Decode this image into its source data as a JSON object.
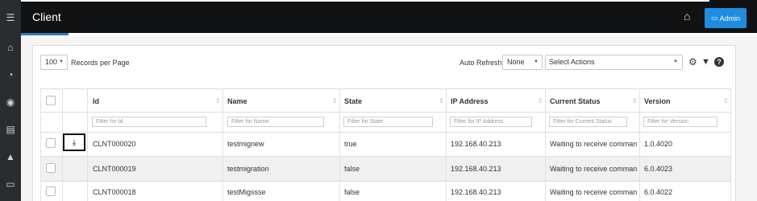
{
  "header": {
    "title": "Client",
    "admin_label": "Admin"
  },
  "sidebar": {
    "icons": [
      "menu-icon",
      "home-icon",
      "dashboard-icon",
      "binoculars-icon",
      "list-icon",
      "alert-icon",
      "monitor-icon"
    ]
  },
  "toolbar": {
    "page_size": "100",
    "records_label": "Records per Page",
    "auto_refresh_label": "Auto Refresh:",
    "auto_refresh_value": "None",
    "actions_value": "Select Actions"
  },
  "table": {
    "columns": [
      "Id",
      "Name",
      "State",
      "IP Address",
      "Current Status",
      "Version"
    ],
    "filters": [
      "Filter for Id",
      "Filter for Name",
      "Filter for State",
      "Filter for IP Address",
      "Filter for Current Status",
      "Filter for Version"
    ],
    "rows": [
      {
        "id": "CLNT000020",
        "name": "testmignew",
        "state": "true",
        "ip": "192.168.40.213",
        "status": "Waiting to receive comman...",
        "version": "1.0.4020"
      },
      {
        "id": "CLNT000019",
        "name": "testmigration",
        "state": "false",
        "ip": "192.168.40.213",
        "status": "Waiting to receive comman...",
        "version": "6.0.4023"
      },
      {
        "id": "CLNT000018",
        "name": "testMigssse",
        "state": "false",
        "ip": "192.168.40.213",
        "status": "Waiting to receive comman...",
        "version": "6.0.4022"
      }
    ]
  },
  "colors": {
    "topbar": "#111213",
    "accent": "#1f8ce0",
    "rail": "#2a2d30"
  }
}
